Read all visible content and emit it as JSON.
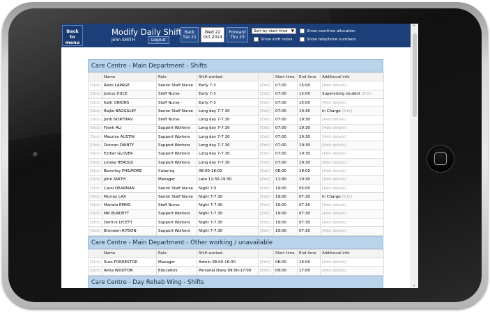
{
  "header": {
    "back_menu_label": "Back\nto\nmenu",
    "title": "Modify Daily Shifts",
    "user": "John SMITH",
    "logout": "Logout",
    "nav_back": "Back\nTue 21",
    "nav_date": "Wed 22\nOct 2014",
    "nav_forward": "Forward\nThu 23",
    "sort_value": "Sort by start time",
    "show_overtime": "Show overtime allocation",
    "show_shift_notes": "Show shift notes",
    "show_telephone": "Show telephone numbers"
  },
  "columns": [
    "Name",
    "Role",
    "Shift worked",
    "",
    "Start time",
    "End time",
    "Additional info"
  ],
  "links": {
    "sick": "[Sick]",
    "edit": "[Edit]",
    "add_details": "[Add details]"
  },
  "sections": [
    {
      "title": "Care Centre - Main Department - Shifts",
      "rows": [
        {
          "name": "Reno LAPAGE",
          "role": "Senior Staff Nurse",
          "shift": "Early 7-3",
          "start": "07:00",
          "end": "15:00",
          "info": ""
        },
        {
          "name": "Justus DUCE",
          "role": "Staff Nurse",
          "shift": "Early 7-3",
          "start": "07:00",
          "end": "15:00",
          "info": "Supervising student"
        },
        {
          "name": "Kath ONIONS",
          "role": "Staff Nurse",
          "shift": "Early 7-3",
          "start": "07:00",
          "end": "15:00",
          "info": ""
        },
        {
          "name": "Rajko BAGGALEY",
          "role": "Senior Staff Nurse",
          "shift": "Long day 7-7.30",
          "start": "07:00",
          "end": "19:30",
          "info": "In Charge"
        },
        {
          "name": "Jordi NORTHAN",
          "role": "Staff Nurse",
          "shift": "Long day 7-7.30",
          "start": "07:00",
          "end": "19:30",
          "info": ""
        },
        {
          "name": "Frank ALI",
          "role": "Support Workers",
          "shift": "Long day 7-7.30",
          "start": "07:00",
          "end": "19:30",
          "info": ""
        },
        {
          "name": "Maurice AUSTIN",
          "role": "Support Workers",
          "shift": "Long day 7-7.30",
          "start": "07:00",
          "end": "19:30",
          "info": ""
        },
        {
          "name": "Duncan DAINTY",
          "role": "Support Workers",
          "shift": "Long day 7-7.30",
          "start": "07:00",
          "end": "19:30",
          "info": ""
        },
        {
          "name": "Esther GLOVER",
          "role": "Support Workers",
          "shift": "Long day 7-7.30",
          "start": "07:00",
          "end": "19:30",
          "info": ""
        },
        {
          "name": "Linsey HEROLD",
          "role": "Support Workers",
          "shift": "Long day 7-7.30",
          "start": "07:00",
          "end": "19:30",
          "info": ""
        },
        {
          "name": "Beverley PHILMORE",
          "role": "Catering",
          "shift": "08:00-18:00",
          "start": "08:00",
          "end": "18:00",
          "info": ""
        },
        {
          "name": "John SMITH",
          "role": "Manager",
          "shift": "Late 11:30-19:30",
          "start": "11:30",
          "end": "19:30",
          "info": ""
        },
        {
          "name": "Carol DEARMAN",
          "role": "Senior Staff Nurse",
          "shift": "Night 7-5",
          "start": "19:00",
          "end": "05:00",
          "info": ""
        },
        {
          "name": "Murray LAX",
          "role": "Senior Staff Nurse",
          "shift": "Night 7-7.30",
          "start": "19:00",
          "end": "07:30",
          "info": "In Charge"
        },
        {
          "name": "Mariela EMMS",
          "role": "Staff Nurse",
          "shift": "Night 7-7.30",
          "start": "19:00",
          "end": "07:30",
          "info": ""
        },
        {
          "name": "MR BURDETT",
          "role": "Support Workers",
          "shift": "Night 7-7.30",
          "start": "19:00",
          "end": "07:30",
          "info": ""
        },
        {
          "name": "Derrick LYCETT",
          "role": "Support Workers",
          "shift": "Night 7-7.30",
          "start": "19:00",
          "end": "07:30",
          "info": ""
        },
        {
          "name": "Bronwen RITSON",
          "role": "Support Workers",
          "shift": "Night 7-7.30",
          "start": "19:00",
          "end": "07:30",
          "info": ""
        }
      ]
    },
    {
      "title": "Care Centre - Main Department - Other working / unavailable",
      "rows": [
        {
          "name": "Russ FORRESTOR",
          "role": "Manager",
          "shift": "Admin 08:00-16:00",
          "start": "08:00",
          "end": "16:00",
          "info": ""
        },
        {
          "name": "Alma WOOTON",
          "role": "Educators",
          "shift": "Personal Diary 09:00-17:00",
          "start": "09:00",
          "end": "17:00",
          "info": ""
        }
      ]
    },
    {
      "title": "Care Centre - Day Rehab Wing - Shifts",
      "rows": []
    }
  ],
  "colors": {
    "header_bg": "#1c3f7a",
    "section_bg": "#b9d3ea"
  }
}
